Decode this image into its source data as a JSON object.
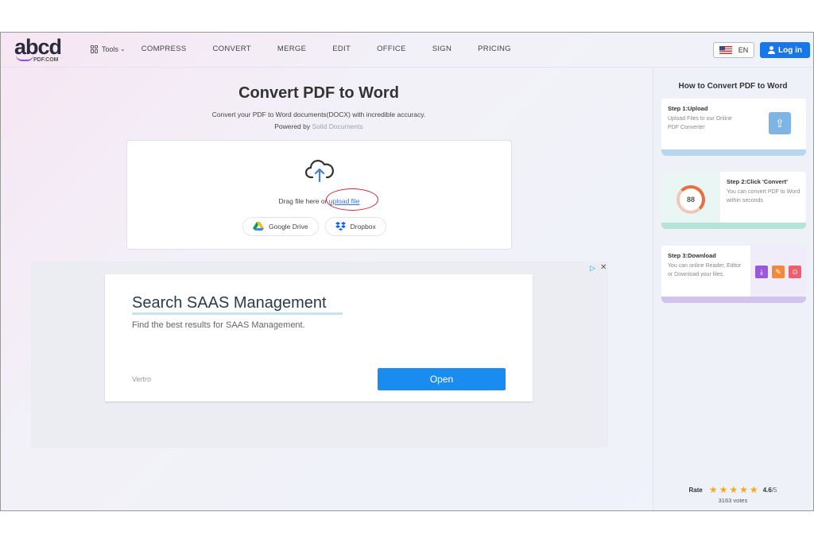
{
  "header": {
    "logo_main": "abcd",
    "logo_sub": "PDF.COM",
    "tools_label": "Tools",
    "nav": [
      "COMPRESS",
      "CONVERT",
      "MERGE",
      "EDIT",
      "OFFICE",
      "SIGN",
      "PRICING"
    ],
    "lang_label": "EN",
    "login_label": "Log in"
  },
  "main": {
    "title": "Convert PDF to Word",
    "description": "Convert your PDF to Word documents(DOCX) with incredible accuracy.",
    "powered_prefix": "Powered by",
    "powered_link": "Solid Documents",
    "drag_text": "Drag file here or",
    "upload_link": "upload file",
    "google_drive_label": "Google Drive",
    "dropbox_label": "Dropbox"
  },
  "ad": {
    "title": "Search SAAS Management",
    "subtitle": "Find the best results for SAAS Management.",
    "brand": "Vertro",
    "open_label": "Open",
    "choices_icon": "ad-choices-icon",
    "close_icon": "close-icon"
  },
  "sidebar": {
    "title": "How to Convert PDF to Word",
    "step1": {
      "label": "Step 1:Upload",
      "text": "Upload Files to our Online PDF Converter"
    },
    "step2": {
      "label": "Step 2:Click 'Convert'",
      "text": "You can convert PDF to Word within seconds",
      "gauge_value": "88"
    },
    "step3": {
      "label": "Step 3:Download",
      "text": "You can online Reader, Editor or Download your files."
    },
    "rate_label": "Rate",
    "rating": "4.6",
    "rating_max": "/5",
    "votes": "3163 votes"
  },
  "colors": {
    "accent": "#1976e8",
    "open_button": "#1a8cf0",
    "star": "#f5a623",
    "annotation_circle": "#dd2233"
  }
}
